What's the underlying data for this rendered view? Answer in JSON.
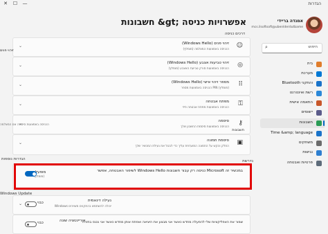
{
  "window": {
    "title": "הגדרות",
    "minimize": "—",
    "maximize": "☐",
    "close": "✕"
  },
  "profile": {
    "name": "אמנדה בריידי",
    "email": "mcs.ilsoftsoft@ubenlderdutbame"
  },
  "search": {
    "placeholder": "חיפוש"
  },
  "nav": {
    "items": [
      {
        "label": "בית",
        "icon": "home-icon",
        "color": "#e07d2c"
      },
      {
        "label": "מערכת",
        "icon": "system-icon",
        "color": "#0078d4"
      },
      {
        "label": "Bluetooth והתקני",
        "icon": "bluetooth-icon",
        "color": "#1a73c9"
      },
      {
        "label": "רשת ואינטרנט",
        "icon": "network-icon",
        "color": "#2b88d8"
      },
      {
        "label": "התאמה אישית",
        "icon": "personalization-icon",
        "color": "#c8572a"
      },
      {
        "label": "יישומים",
        "icon": "apps-icon",
        "color": "#5b5b8a"
      },
      {
        "label": "חשבונות",
        "icon": "accounts-icon",
        "color": "#2a9b55"
      },
      {
        "label": "Time &amp; language",
        "icon": "time-language-icon",
        "color": "#1a73c9"
      },
      {
        "label": "משחקים",
        "icon": "gaming-icon",
        "color": "#6b6b6b"
      },
      {
        "label": "נגישות",
        "icon": "accessibility-icon",
        "color": "#2e7fd0"
      },
      {
        "label": "פרטיות ואבטחה",
        "icon": "privacy-shield-icon",
        "color": "#5d6b7a"
      },
      {
        "label": "Windows Update",
        "icon": "update-icon",
        "color": "#0078d4"
      }
    ]
  },
  "page": {
    "title": "חשבונות &gt;   אפשרויות כניסה"
  },
  "sections": {
    "signin_ways": "דרכים כניסה",
    "additional": "הגדרות נוספות",
    "side_right": "נדרשת"
  },
  "cards": [
    {
      "title": "(Windows Hello) זיהוי פנים",
      "sub": "הכניסה באמצעות המצלמה (מומלץ)",
      "icon": "☺"
    },
    {
      "title": "(Windows Hello) זיהוי טביעות אצבע",
      "sub": "הכניסה באמצעות סורק טביעת האצבע (מומלץ)",
      "icon": "◎"
    },
    {
      "title": "(Windows Hello) מספר זיהוי אישי",
      "sub": "הכניסה באמצעות מספר PIN (מומלץ)",
      "icon": "⠿"
    },
    {
      "title": "מפתח אבטחה",
      "sub": "הכניסה באמצעות מפתח אבטחה פיזי",
      "icon": "⚿"
    },
    {
      "title": "סיסמה",
      "sub": "הכניסה באמצעות סיסמת החשבון שלך",
      "icon": "⚷",
      "extra": "חשבונות"
    },
    {
      "title": "סיסמת תמונה",
      "sub": "החלק והקש על התמונה המועדפת עליך כדי לבטל את נעילת המכשיר שלך",
      "icon": "▣"
    }
  ],
  "truncated": {
    "line1": "זיהוי פנים",
    "line2": "הכניסה באמצעות סיסמה אם המצלמה",
    "dots": "..."
  },
  "highlight": {
    "text": "לשיפור האבטחה, אפשר Windows Hello כניסה רק עבור חשבונות Microsoft במכשיר זה",
    "sub": "(מומלץ)",
    "toggle_label": "מופעל",
    "state": "on"
  },
  "dynamic_lock": {
    "title": "נעילה דינאמית",
    "sub": "Windows יכולה להשתמש בהתקנים משויכים",
    "toggle_label": "כבוי",
    "state": "off"
  },
  "restart_apps": {
    "title": "שמור את האפליקציות שלי להפעלה מחדש כאשר אני מבצע את היציאה ואפתח אותן מחדש כאשר אני נכנס בחזרה",
    "toggle_label": "כבוי",
    "state": "off",
    "side": "אוריינטציה שונה"
  }
}
